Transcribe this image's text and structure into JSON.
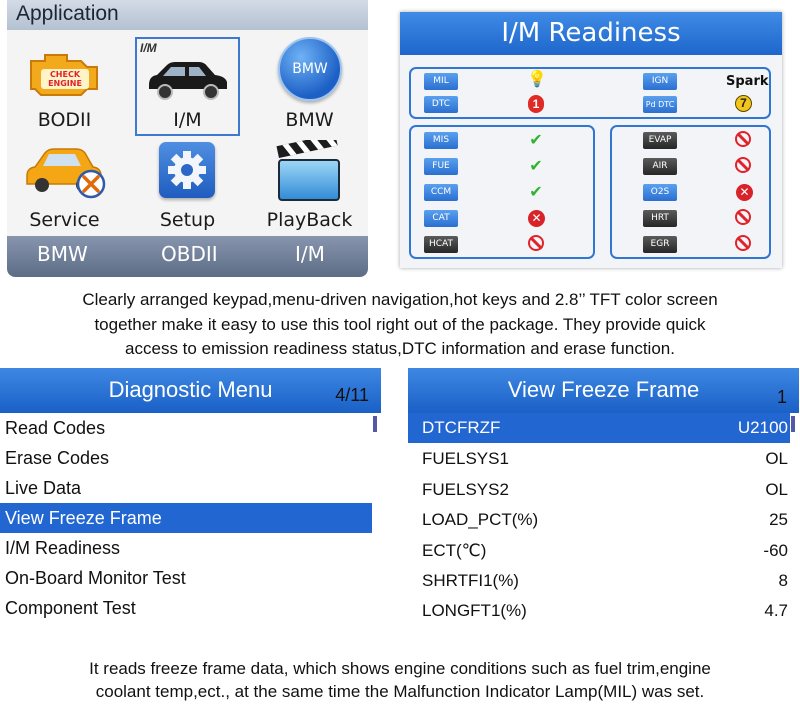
{
  "app_menu": {
    "title": "Application",
    "tiles": [
      {
        "label": "BODII",
        "icon": "check-engine-icon",
        "badge": "CHECK ENGINE"
      },
      {
        "label": "I/M",
        "icon": "car-icon",
        "badge": "I/M"
      },
      {
        "label": "BMW",
        "icon": "bmw-logo-icon",
        "badge": "BMW"
      },
      {
        "label": "Service",
        "icon": "service-car-icon"
      },
      {
        "label": "Setup",
        "icon": "gear-icon"
      },
      {
        "label": "PlayBack",
        "icon": "clapperboard-icon"
      }
    ],
    "bottom_keys": [
      "BMW",
      "OBDII",
      "I/M"
    ]
  },
  "im_readiness": {
    "title": "I/M Readiness",
    "top_left": [
      {
        "tag": "MIL",
        "status": "bulb"
      },
      {
        "tag": "DTC",
        "status": "1"
      }
    ],
    "top_right": [
      {
        "tag": "IGN",
        "value": "Spark"
      },
      {
        "tag": "Pd DTC",
        "status": "7"
      }
    ],
    "left_monitors": [
      {
        "tag": "MIS",
        "status": "complete"
      },
      {
        "tag": "FUE",
        "status": "complete"
      },
      {
        "tag": "CCM",
        "status": "complete"
      },
      {
        "tag": "CAT",
        "status": "incomplete"
      },
      {
        "tag": "HCAT",
        "status": "not-supported"
      }
    ],
    "right_monitors": [
      {
        "tag": "EVAP",
        "status": "not-supported"
      },
      {
        "tag": "AIR",
        "status": "not-supported"
      },
      {
        "tag": "O2S",
        "status": "incomplete"
      },
      {
        "tag": "HRT",
        "status": "not-supported"
      },
      {
        "tag": "EGR",
        "status": "not-supported"
      }
    ]
  },
  "caption_1": [
    "Clearly arranged keypad,menu-driven navigation,hot keys and 2.8’’ TFT color  screen",
    "together make it easy to use this tool right out of the package. They provide quick",
    "access to emission readiness status,DTC information and erase function."
  ],
  "diagnostic_menu": {
    "title": "Diagnostic Menu",
    "page": "4/11",
    "items": [
      "Read Codes",
      "Erase Codes",
      "Live Data",
      "View Freeze Frame",
      "I/M Readiness",
      "On-Board Monitor Test",
      "Component Test"
    ],
    "selected_index": 3
  },
  "freeze_frame": {
    "title": "View Freeze Frame",
    "page": "1",
    "rows": [
      {
        "name": "DTCFRZF",
        "value": "U2100"
      },
      {
        "name": "FUELSYS1",
        "value": "OL"
      },
      {
        "name": "FUELSYS2",
        "value": "OL"
      },
      {
        "name": "LOAD_PCT(%)",
        "value": "25"
      },
      {
        "name": "ECT(℃)",
        "value": "-60"
      },
      {
        "name": "SHRTFI1(%)",
        "value": "8"
      },
      {
        "name": "LONGFT1(%)",
        "value": "4.7"
      }
    ],
    "selected_index": 0
  },
  "caption_2": [
    "It reads freeze frame data, which shows engine conditions such as fuel trim,engine",
    "coolant temp,ect., at the same time the Malfunction Indicator Lamp(MIL) was set."
  ],
  "colors": {
    "accent_blue": "#2266d2",
    "status_green": "#2fb42f",
    "status_red": "#e0232a",
    "status_yellow": "#f3c51a"
  }
}
